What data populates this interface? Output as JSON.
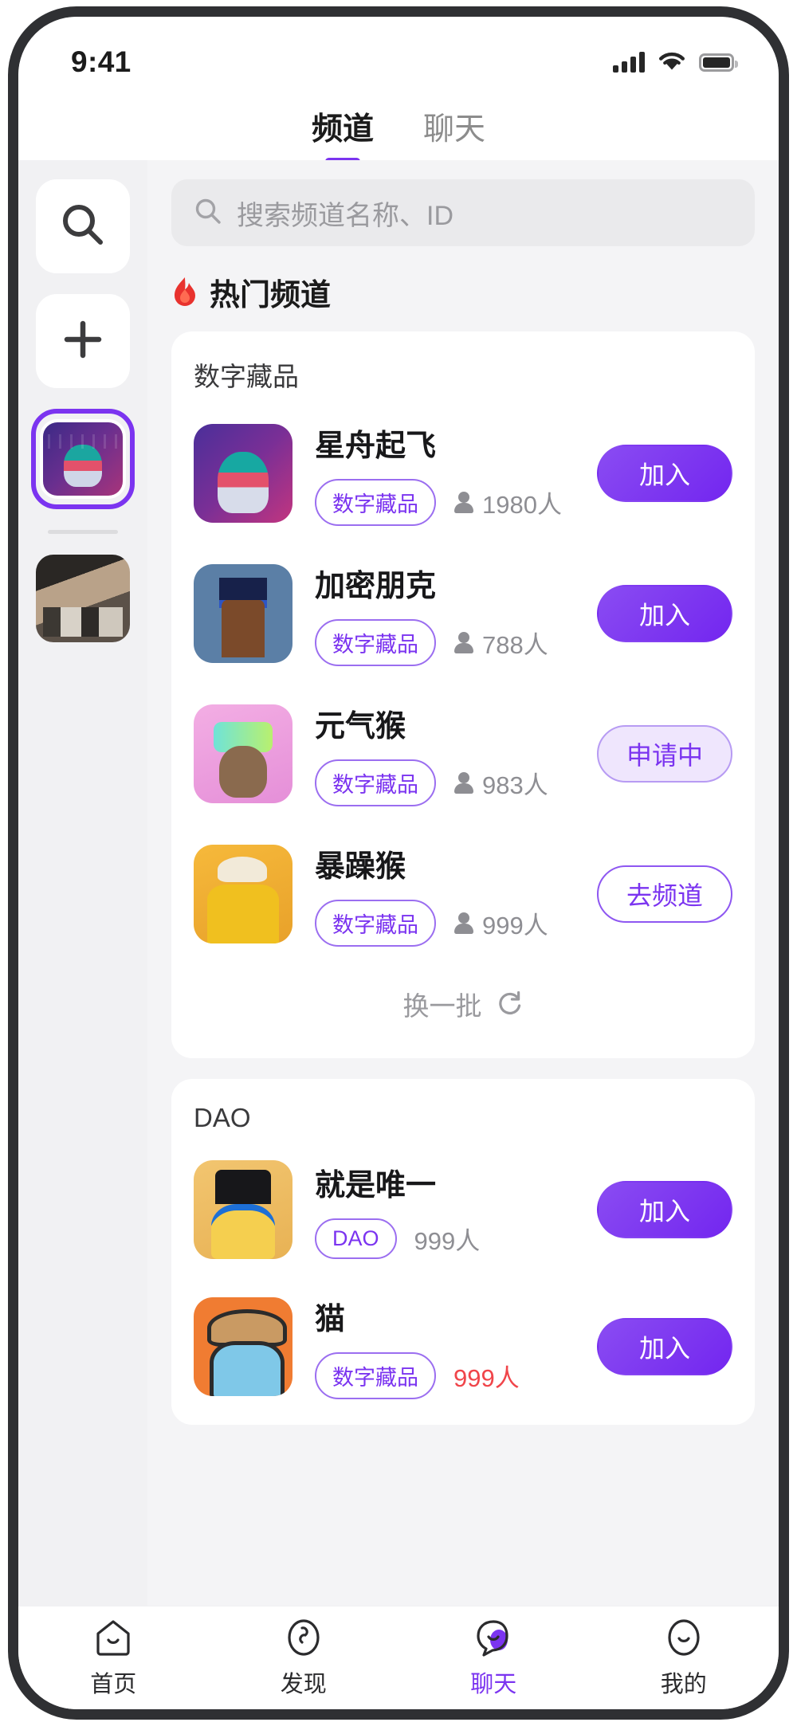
{
  "status_bar": {
    "time": "9:41",
    "signal_icon": "signal-bars-icon",
    "wifi_icon": "wifi-icon",
    "battery_icon": "battery-full-icon"
  },
  "top_tabs": {
    "items": [
      {
        "label": "频道",
        "active": true
      },
      {
        "label": "聊天",
        "active": false
      }
    ],
    "indicator_color": "#7b34f0"
  },
  "left_rail": {
    "search_icon": "search-icon",
    "add_icon": "plus-icon",
    "servers": [
      {
        "name": "cyber-girl-avatar",
        "selected": true
      },
      {
        "name": "office-photo-avatar",
        "selected": false
      }
    ]
  },
  "search": {
    "placeholder": "搜索频道名称、ID",
    "icon": "search-icon"
  },
  "sections": [
    {
      "header": "热门频道",
      "header_icon": "fire-icon",
      "card_title": "数字藏品",
      "channels": [
        {
          "name": "星舟起飞",
          "tag": "数字藏品",
          "members": "1980人",
          "button": "加入",
          "button_style": "join",
          "thumb": "t1"
        },
        {
          "name": "加密朋克",
          "tag": "数字藏品",
          "members": "788人",
          "button": "加入",
          "button_style": "join",
          "thumb": "t2"
        },
        {
          "name": "元气猴",
          "tag": "数字藏品",
          "members": "983人",
          "button": "申请中",
          "button_style": "pending",
          "thumb": "t3"
        },
        {
          "name": "暴躁猴",
          "tag": "数字藏品",
          "members": "999人",
          "button": "去频道",
          "button_style": "goto",
          "thumb": "t4"
        }
      ],
      "more_label": "换一批",
      "more_icon": "refresh-icon"
    },
    {
      "card_title": "DAO",
      "channels": [
        {
          "name": "就是唯一",
          "tag": "DAO",
          "members": "999人",
          "button": "加入",
          "button_style": "join",
          "thumb": "t5"
        },
        {
          "name": "猫",
          "tag": "数字藏品",
          "members": "999人",
          "button": "加入",
          "button_style": "join",
          "thumb": "t6",
          "members_highlight": true
        }
      ]
    }
  ],
  "bottom_nav": {
    "items": [
      {
        "label": "首页",
        "icon": "home-icon",
        "active": false
      },
      {
        "label": "发现",
        "icon": "compass-icon",
        "active": false
      },
      {
        "label": "聊天",
        "icon": "chat-bubble-icon",
        "active": true
      },
      {
        "label": "我的",
        "icon": "profile-icon",
        "active": false
      }
    ],
    "active_color": "#7b34f0"
  }
}
